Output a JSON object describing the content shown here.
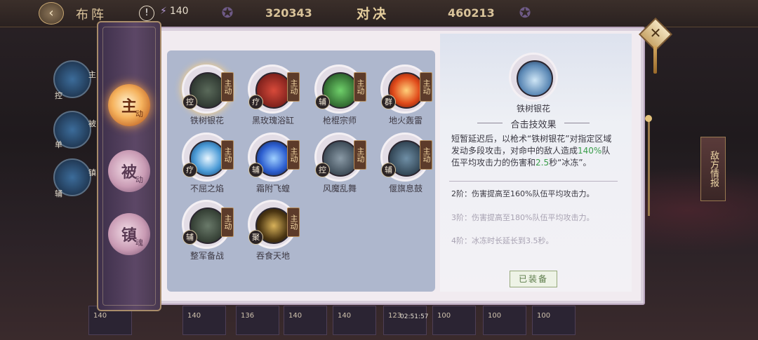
{
  "topbar": {
    "back_icon": "back-arrow-icon",
    "title": "布阵",
    "alert_symbol": "!",
    "stamina": "140",
    "score_left": "320343",
    "vs_title": "对决",
    "score_right": "460213"
  },
  "left_units": {
    "tags": [
      "主",
      "控",
      "被",
      "单",
      "镇",
      "辅"
    ]
  },
  "bottom_bar": {
    "slots": [
      "140",
      "140",
      "136",
      "140",
      "140",
      "123",
      "100",
      "100",
      "100"
    ],
    "timer": "02:51:57"
  },
  "rail": {
    "tabs": [
      {
        "main": "主",
        "sub": "动",
        "active": true
      },
      {
        "main": "被",
        "sub": "动",
        "active": false
      },
      {
        "main": "镇",
        "sub": "魂",
        "active": false
      }
    ]
  },
  "skills": [
    {
      "name": "铁树银花",
      "type": "控",
      "tag": "主动",
      "icon": "iron-tree-skill-icon"
    },
    {
      "name": "黑玫瑰浴缸",
      "type": "疗",
      "tag": "主动",
      "icon": "black-rose-skill-icon"
    },
    {
      "name": "枪棍宗师",
      "type": "辅",
      "tag": "主动",
      "icon": "spear-master-skill-icon"
    },
    {
      "name": "地火轰雷",
      "type": "群",
      "tag": "主动",
      "icon": "earth-fire-skill-icon"
    },
    {
      "name": "不屈之焰",
      "type": "疗",
      "tag": "主动",
      "icon": "unyielding-flame-skill-icon"
    },
    {
      "name": "霜附飞蝗",
      "type": "辅",
      "tag": "主动",
      "icon": "frost-locust-skill-icon"
    },
    {
      "name": "风魔乱舞",
      "type": "控",
      "tag": "主动",
      "icon": "wind-demon-skill-icon"
    },
    {
      "name": "偃旗息鼓",
      "type": "辅",
      "tag": "主动",
      "icon": "banner-drum-skill-icon"
    },
    {
      "name": "整军备战",
      "type": "辅",
      "tag": "主动",
      "icon": "army-prep-skill-icon"
    },
    {
      "name": "吞食天地",
      "type": "聚",
      "tag": "主动",
      "icon": "devour-world-skill-icon"
    }
  ],
  "detail": {
    "name": "铁树银花",
    "heading": "合击技效果",
    "desc_part1": "短暂延迟后，以枪术“铁树银花”对指定区域发动多段攻击，对命中的敌人造成",
    "desc_pct": "140%",
    "desc_part2": "队伍平均攻击力的伤害和",
    "desc_sec": "2.5",
    "desc_part3": "秒“冰冻”。",
    "tiers": [
      {
        "text": "2阶：伤害提高至160%队伍平均攻击力。",
        "unlocked": true
      },
      {
        "text": "3阶：伤害提高至180%队伍平均攻击力。",
        "unlocked": false
      },
      {
        "text": "4阶：冰冻时长延长到3.5秒。",
        "unlocked": false
      }
    ],
    "equip_label": "已装备"
  },
  "side_tab": "敌方情报",
  "colors": {
    "highlight": "#3a9d4a",
    "active_tab": "#f5b25d",
    "skills_bg": "#aeb7cd"
  }
}
